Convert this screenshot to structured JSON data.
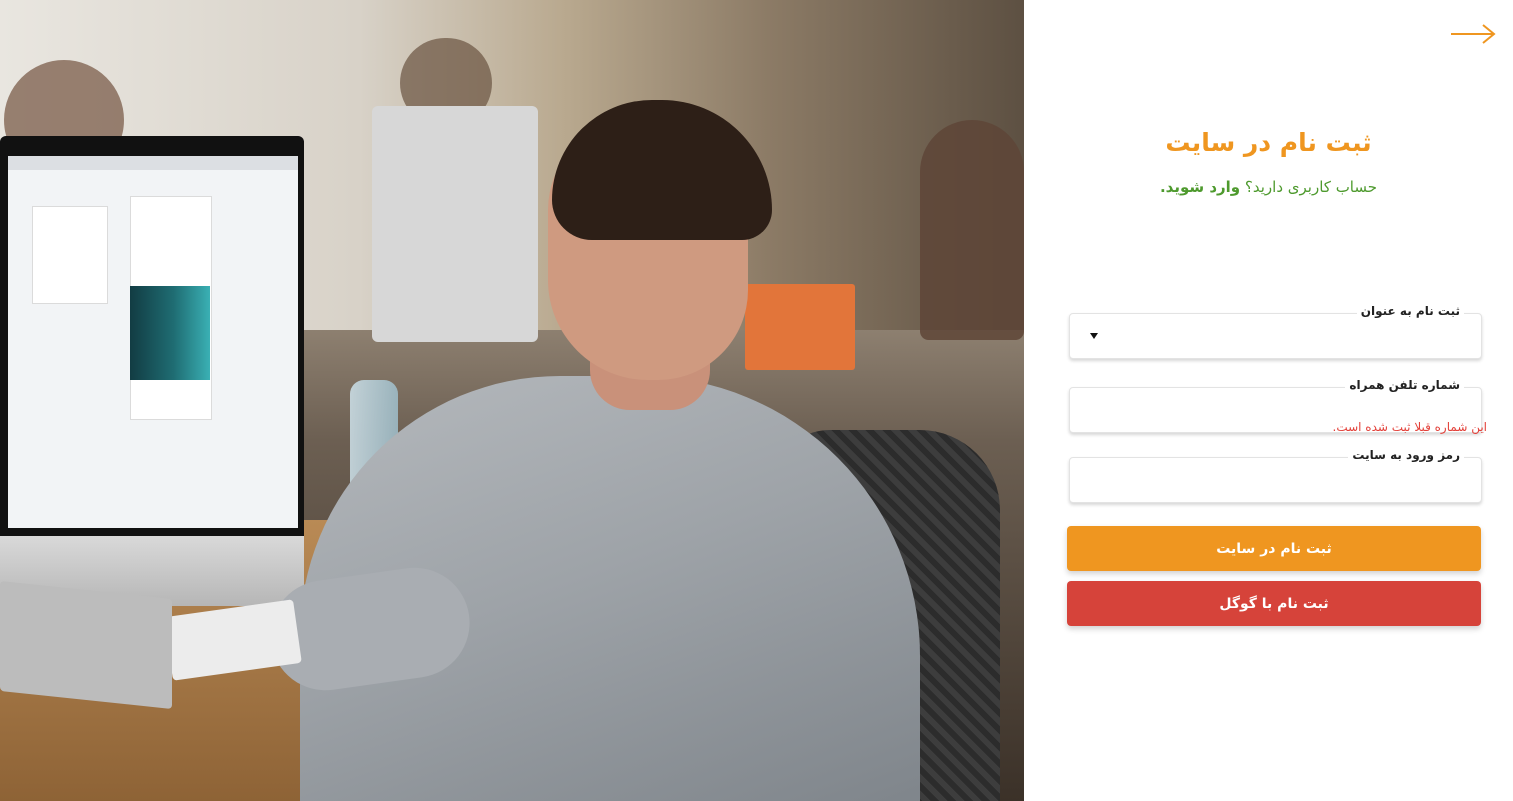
{
  "form": {
    "title": "ثبت نام در سایت",
    "subtitle_prefix": "حساب کاربری دارید؟",
    "login_link": "وارد شوید.",
    "role_label": "ثبت نام به عنوان",
    "role_value": "",
    "phone_label": "شماره تلفن همراه",
    "phone_value": "",
    "phone_error": "این شماره قبلا ثبت شده است.",
    "password_label": "رمز ورود به سایت",
    "password_value": "",
    "register_button": "ثبت نام در سایت",
    "google_button": "ثبت نام با گوگل"
  },
  "icons": {
    "back": "arrow-right-icon",
    "dropdown": "caret-down-icon"
  },
  "colors": {
    "primary": "#ef9620",
    "link": "#4e9a2e",
    "error": "#e3413a",
    "google": "#d6433a"
  }
}
